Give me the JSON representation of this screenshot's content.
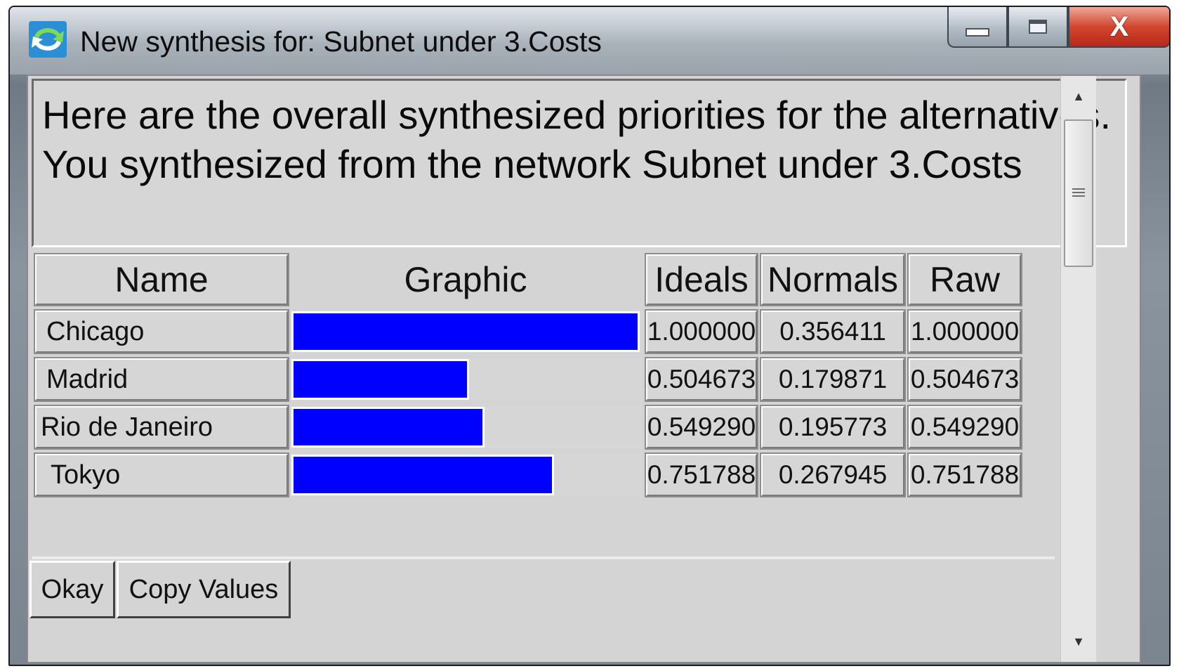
{
  "window": {
    "title": "New synthesis for: Subnet under 3.Costs",
    "minimize_icon": "minimize-icon",
    "maximize_icon": "maximize-icon",
    "close_glyph": "X"
  },
  "message": "Here are the overall synthesized priorities for the alternatives.  You synthesized from the network Subnet under 3.Costs",
  "table": {
    "headers": {
      "name": "Name",
      "graphic": "Graphic",
      "ideals": "Ideals",
      "normals": "Normals",
      "raw": "Raw"
    },
    "rows": [
      {
        "name": "Chicago",
        "ideals": "1.000000",
        "normals": "0.356411",
        "raw": "1.000000",
        "bar_fraction": 1.0
      },
      {
        "name": "Madrid",
        "ideals": "0.504673",
        "normals": "0.179871",
        "raw": "0.504673",
        "bar_fraction": 0.504673
      },
      {
        "name": "Rio de Janeiro",
        "ideals": "0.549290",
        "normals": "0.195773",
        "raw": "0.549290",
        "bar_fraction": 0.54929
      },
      {
        "name": "Tokyo",
        "ideals": "0.751788",
        "normals": "0.267945",
        "raw": "0.751788",
        "bar_fraction": 0.751788
      }
    ],
    "bar_color": "#0000ff"
  },
  "buttons": {
    "okay": "Okay",
    "copy_values": "Copy Values"
  }
}
